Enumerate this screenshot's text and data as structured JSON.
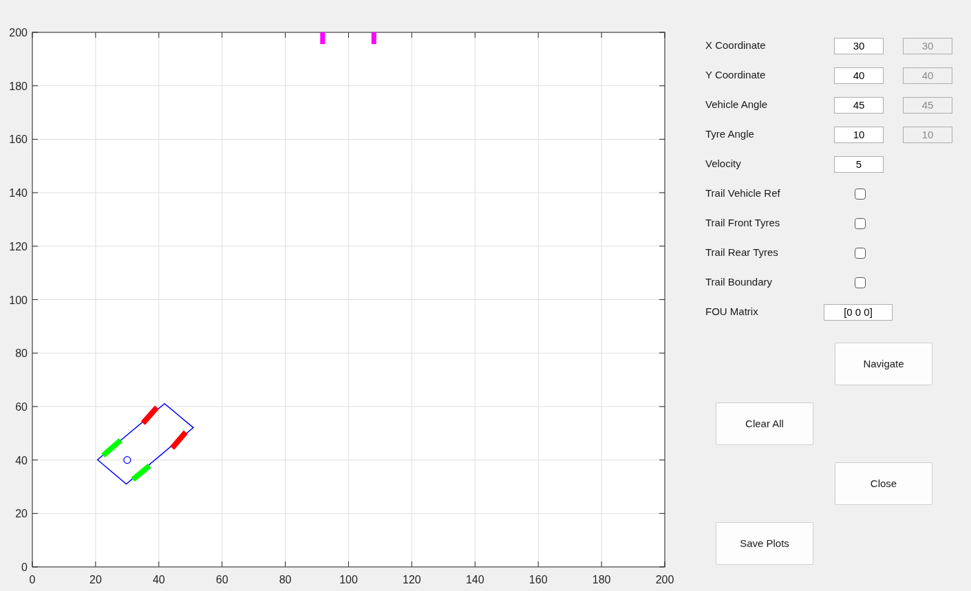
{
  "axes": {
    "chart_data": {
      "type": "line",
      "grid": true,
      "xlim": [
        0,
        200
      ],
      "ylim": [
        0,
        200
      ],
      "xticks": [
        0,
        20,
        40,
        60,
        80,
        100,
        120,
        140,
        160,
        180,
        200
      ],
      "yticks": [
        0,
        20,
        40,
        60,
        80,
        100,
        120,
        140,
        160,
        180,
        200
      ]
    }
  },
  "fields": [
    {
      "label": "X Coordinate",
      "value": "30",
      "display": "30"
    },
    {
      "label": "Y Coordinate",
      "value": "40",
      "display": "40"
    },
    {
      "label": "Vehicle Angle",
      "value": "45",
      "display": "45"
    },
    {
      "label": "Tyre Angle",
      "value": "10",
      "display": "10"
    },
    {
      "label": "Velocity",
      "value": "5"
    }
  ],
  "checkboxes": [
    {
      "label": "Trail Vehicle Ref",
      "checked": false
    },
    {
      "label": "Trail Front Tyres",
      "checked": false
    },
    {
      "label": "Trail Rear Tyres",
      "checked": false
    },
    {
      "label": "Trail Boundary",
      "checked": false
    }
  ],
  "matrix_field": {
    "label": "FOU Matrix",
    "value": "[0 0 0]"
  },
  "buttons": [
    "Navigate",
    "Clear All",
    "Close",
    "Save Plots"
  ]
}
